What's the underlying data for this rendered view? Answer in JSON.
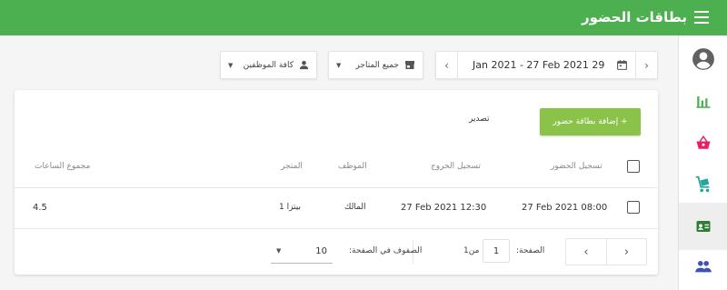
{
  "header": {
    "title": "بطاقات الحضور",
    "menu_icon": "menu-icon"
  },
  "sidebar": {
    "items": [
      {
        "name": "account",
        "icon": "account-circle-icon",
        "color": "#616161"
      },
      {
        "name": "reports",
        "icon": "bar-chart-icon",
        "color": "#4caf50"
      },
      {
        "name": "sales",
        "icon": "basket-icon",
        "color": "#e91e63"
      },
      {
        "name": "inventory",
        "icon": "cart-icon",
        "color": "#26a69a"
      },
      {
        "name": "employees",
        "icon": "badge-icon",
        "color": "#2e7d32",
        "active": true
      },
      {
        "name": "customers",
        "icon": "people-icon",
        "color": "#3f51b5"
      }
    ]
  },
  "filters": {
    "date_range": "Jan 2021 - 27 Feb 2021 29",
    "store": "جميع المتاجر",
    "employee": "كافة الموظفين"
  },
  "actions": {
    "add_label": "+ إضافة بطاقة حضور",
    "export_label": "تصدير"
  },
  "table": {
    "headers": {
      "clock_in": "تسجيل الحضور",
      "clock_out": "تسجيل الخروج",
      "employee": "الموظف",
      "store": "المتجر",
      "total_hours": "مجموع الساعات"
    },
    "rows": [
      {
        "clock_in": "27 Feb 2021 08:00",
        "clock_out": "27 Feb 2021 12:30",
        "employee": "المالك",
        "store": "بيتزا 1",
        "total_hours": "4.5"
      }
    ]
  },
  "pagination": {
    "page_label": "الصفحة:",
    "current_page": "1",
    "of_label": "من",
    "total_pages": "1",
    "rows_per_page_label": "الصفوف في الصفحة:",
    "rows_per_page": "10"
  },
  "colors": {
    "header": "#4caf50",
    "add_button": "#8bc34a"
  }
}
